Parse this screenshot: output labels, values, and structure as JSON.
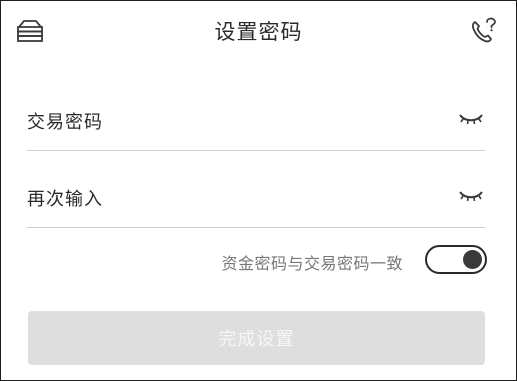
{
  "header": {
    "title": "设置密码",
    "left_icon": "menu-icon",
    "right_icon": "phone-help-icon"
  },
  "form": {
    "fields": [
      {
        "label": "交易密码",
        "value": "",
        "icon": "eye-closed-icon"
      },
      {
        "label": "再次输入",
        "value": "",
        "icon": "eye-closed-icon"
      }
    ]
  },
  "sync_toggle": {
    "label": "资金密码与交易密码一致",
    "state": "on"
  },
  "submit": {
    "label": "完成设置",
    "enabled": false
  },
  "colors": {
    "text": "#2b2b2b",
    "muted_text": "#777777",
    "divider": "#cfcfcf",
    "disabled_button": "#dedede",
    "toggle": "#2a2a2a"
  }
}
